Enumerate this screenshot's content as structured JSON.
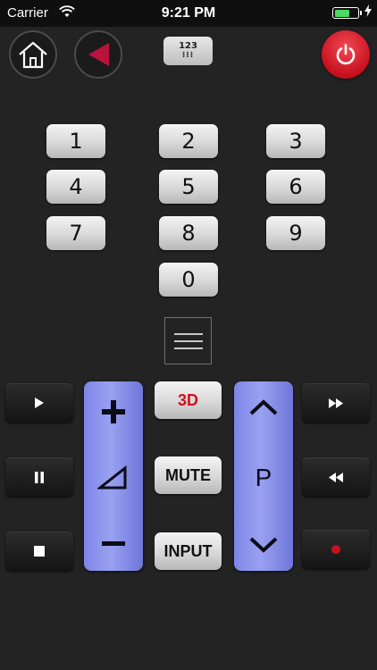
{
  "status_bar": {
    "carrier": "Carrier",
    "time": "9:21 PM",
    "battery_percent": 70,
    "battery_color": "#4cd964"
  },
  "top_controls": {
    "home_icon": "home-icon",
    "back_icon": "back-triangle-icon",
    "keypad_toggle": {
      "line1": "123",
      "line2": "⁝⁝⁝"
    },
    "power_icon": "power-icon",
    "power_color": "#d41420"
  },
  "number_pad": {
    "keys": [
      "1",
      "2",
      "3",
      "4",
      "5",
      "6",
      "7",
      "8",
      "9",
      "0"
    ]
  },
  "menu_icon": "menu-icon",
  "playback": {
    "left": [
      "play-icon",
      "pause-icon",
      "stop-icon"
    ],
    "right": [
      "fast-forward-icon",
      "rewind-icon",
      "record-icon"
    ],
    "record_color": "#c8101e"
  },
  "volume_rocker": {
    "up_icon": "plus-icon",
    "middle_icon": "volume-icon",
    "down_icon": "minus-icon",
    "color": "#8890ec"
  },
  "center_buttons": {
    "threed_label": "3D",
    "mute_label": "MUTE",
    "input_label": "INPUT"
  },
  "channel_rocker": {
    "up_icon": "chevron-up-icon",
    "label": "P",
    "down_icon": "chevron-down-icon"
  }
}
